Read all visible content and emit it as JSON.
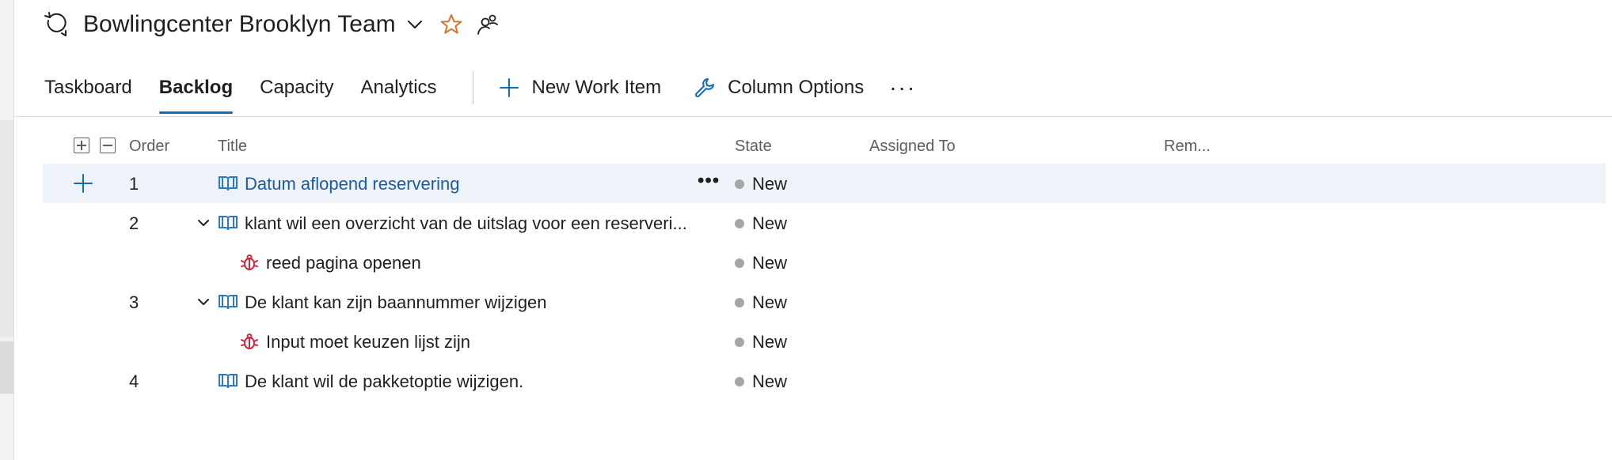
{
  "header": {
    "team_name": "Bowlingcenter Brooklyn Team",
    "team_icon": "refresh-team-icon",
    "favorite_icon": "star-icon",
    "members_icon": "people-icon",
    "star_color": "#d9752a"
  },
  "tabs": [
    {
      "label": "Taskboard",
      "active": false
    },
    {
      "label": "Backlog",
      "active": true
    },
    {
      "label": "Capacity",
      "active": false
    },
    {
      "label": "Analytics",
      "active": false
    }
  ],
  "toolbar": {
    "new_work_item": "New Work Item",
    "column_options": "Column Options",
    "more": "···"
  },
  "columns": {
    "order": "Order",
    "title": "Title",
    "state": "State",
    "assigned_to": "Assigned To",
    "remaining": "Rem..."
  },
  "rows": [
    {
      "order": "1",
      "type": "user-story",
      "title": "Datum aflopend reservering",
      "state": "New",
      "selected": true
    },
    {
      "order": "2",
      "type": "user-story",
      "title": "klant wil een overzicht van de uitslag voor een reserveri...",
      "state": "New",
      "expanded": true
    },
    {
      "order": "",
      "type": "bug",
      "title": "reed pagina openen",
      "state": "New",
      "child": true
    },
    {
      "order": "3",
      "type": "user-story",
      "title": "De klant kan zijn baannummer wijzigen",
      "state": "New",
      "expanded": true
    },
    {
      "order": "",
      "type": "bug",
      "title": "Input moet keuzen lijst zijn",
      "state": "New",
      "child": true
    },
    {
      "order": "4",
      "type": "user-story",
      "title": "De klant wil de pakketoptie wijzigen.",
      "state": "New"
    }
  ],
  "colors": {
    "accent": "#0f6cbd",
    "link": "#1c5aa5",
    "story_icon": "#2f78c4",
    "bug_icon": "#cc293d",
    "state_new": "#a8a6a4"
  }
}
